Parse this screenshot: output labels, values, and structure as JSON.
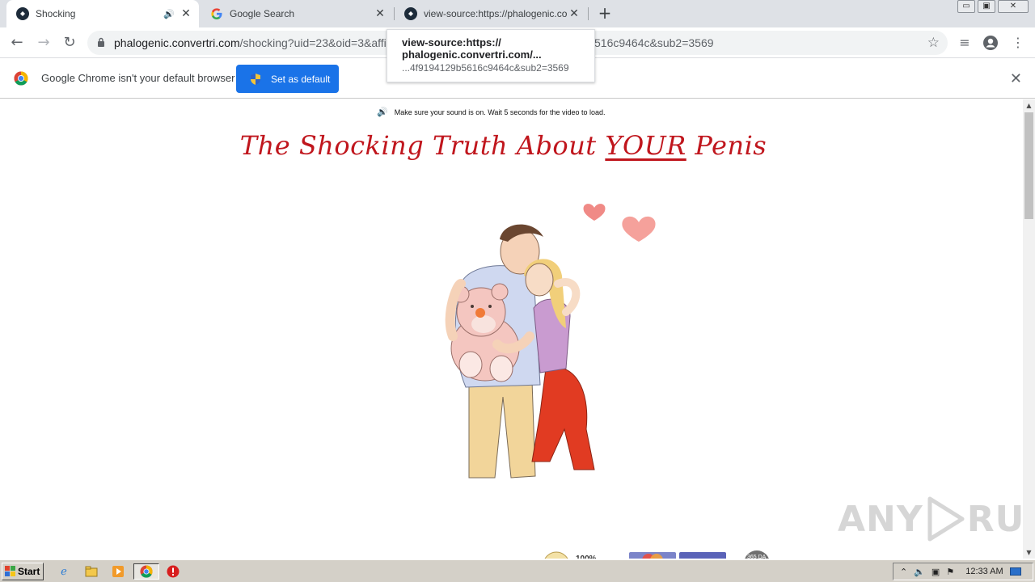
{
  "tabs": [
    {
      "title": "Shocking",
      "active": true,
      "audio": true
    },
    {
      "title": "Google Search",
      "active": false,
      "audio": false
    },
    {
      "title": "view-source:https://phalogenic.conv",
      "active": false,
      "audio": false
    }
  ],
  "window_buttons": {
    "minimize": "▭",
    "restore": "▣",
    "close": "✕"
  },
  "omnibox": {
    "domain": "phalogenic.convertri.com",
    "path": "/shocking?uid=23&oid=3&affi",
    "path_tail": "516c9464c&sub2=3569"
  },
  "tooltip": {
    "line1": "view-source:https://",
    "line2": "phalogenic.convertri.com/...",
    "line3": "...4f9194129b5616c9464c&sub2=3569"
  },
  "infobar": {
    "message": "Google Chrome isn't your default browser",
    "button_label": "Set as default"
  },
  "page": {
    "sound_note": "Make sure your sound is on. Wait 5 seconds for the video to load.",
    "headline_pre": "The Shocking Truth About ",
    "headline_emph": "YOUR",
    "headline_post": " Penis"
  },
  "watermark": {
    "left": "ANY",
    "right": "RUN"
  },
  "taskbar": {
    "start_label": "Start",
    "clock": "12:33 AM"
  },
  "colors": {
    "accent": "#1a73e8",
    "headline": "#c0161d",
    "tabstrip": "#dee1e6"
  }
}
